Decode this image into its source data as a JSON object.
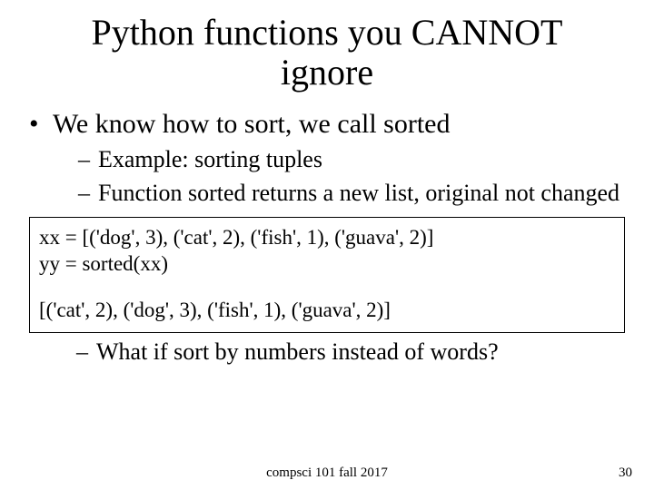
{
  "title": "Python functions you CANNOT ignore",
  "bullet1": "We know how to sort, we call sorted",
  "sub1": "Example: sorting tuples",
  "sub2": "Function sorted returns a new list, original not changed",
  "code": {
    "line1": "xx = [('dog', 3), ('cat', 2), ('fish', 1),  ('guava', 2)]",
    "line2": "yy = sorted(xx)",
    "line3": "[('cat', 2), ('dog', 3), ('fish', 1), ('guava', 2)]"
  },
  "sub3": "What if sort by numbers instead of words?",
  "footer": "compsci 101 fall 2017",
  "page": "30"
}
